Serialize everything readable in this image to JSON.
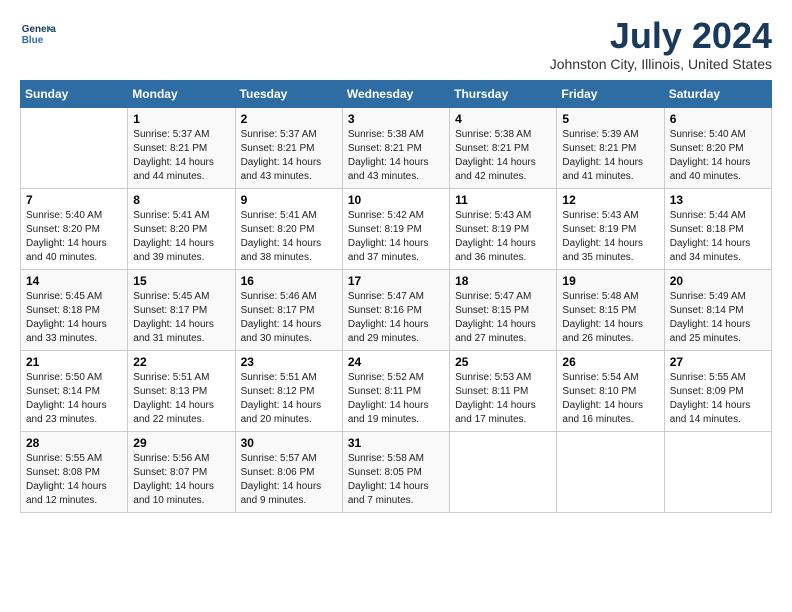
{
  "header": {
    "logo_line1": "General",
    "logo_line2": "Blue",
    "title": "July 2024",
    "subtitle": "Johnston City, Illinois, United States"
  },
  "weekdays": [
    "Sunday",
    "Monday",
    "Tuesday",
    "Wednesday",
    "Thursday",
    "Friday",
    "Saturday"
  ],
  "weeks": [
    [
      {
        "day": "",
        "info": ""
      },
      {
        "day": "1",
        "info": "Sunrise: 5:37 AM\nSunset: 8:21 PM\nDaylight: 14 hours\nand 44 minutes."
      },
      {
        "day": "2",
        "info": "Sunrise: 5:37 AM\nSunset: 8:21 PM\nDaylight: 14 hours\nand 43 minutes."
      },
      {
        "day": "3",
        "info": "Sunrise: 5:38 AM\nSunset: 8:21 PM\nDaylight: 14 hours\nand 43 minutes."
      },
      {
        "day": "4",
        "info": "Sunrise: 5:38 AM\nSunset: 8:21 PM\nDaylight: 14 hours\nand 42 minutes."
      },
      {
        "day": "5",
        "info": "Sunrise: 5:39 AM\nSunset: 8:21 PM\nDaylight: 14 hours\nand 41 minutes."
      },
      {
        "day": "6",
        "info": "Sunrise: 5:40 AM\nSunset: 8:20 PM\nDaylight: 14 hours\nand 40 minutes."
      }
    ],
    [
      {
        "day": "7",
        "info": "Sunrise: 5:40 AM\nSunset: 8:20 PM\nDaylight: 14 hours\nand 40 minutes."
      },
      {
        "day": "8",
        "info": "Sunrise: 5:41 AM\nSunset: 8:20 PM\nDaylight: 14 hours\nand 39 minutes."
      },
      {
        "day": "9",
        "info": "Sunrise: 5:41 AM\nSunset: 8:20 PM\nDaylight: 14 hours\nand 38 minutes."
      },
      {
        "day": "10",
        "info": "Sunrise: 5:42 AM\nSunset: 8:19 PM\nDaylight: 14 hours\nand 37 minutes."
      },
      {
        "day": "11",
        "info": "Sunrise: 5:43 AM\nSunset: 8:19 PM\nDaylight: 14 hours\nand 36 minutes."
      },
      {
        "day": "12",
        "info": "Sunrise: 5:43 AM\nSunset: 8:19 PM\nDaylight: 14 hours\nand 35 minutes."
      },
      {
        "day": "13",
        "info": "Sunrise: 5:44 AM\nSunset: 8:18 PM\nDaylight: 14 hours\nand 34 minutes."
      }
    ],
    [
      {
        "day": "14",
        "info": "Sunrise: 5:45 AM\nSunset: 8:18 PM\nDaylight: 14 hours\nand 33 minutes."
      },
      {
        "day": "15",
        "info": "Sunrise: 5:45 AM\nSunset: 8:17 PM\nDaylight: 14 hours\nand 31 minutes."
      },
      {
        "day": "16",
        "info": "Sunrise: 5:46 AM\nSunset: 8:17 PM\nDaylight: 14 hours\nand 30 minutes."
      },
      {
        "day": "17",
        "info": "Sunrise: 5:47 AM\nSunset: 8:16 PM\nDaylight: 14 hours\nand 29 minutes."
      },
      {
        "day": "18",
        "info": "Sunrise: 5:47 AM\nSunset: 8:15 PM\nDaylight: 14 hours\nand 27 minutes."
      },
      {
        "day": "19",
        "info": "Sunrise: 5:48 AM\nSunset: 8:15 PM\nDaylight: 14 hours\nand 26 minutes."
      },
      {
        "day": "20",
        "info": "Sunrise: 5:49 AM\nSunset: 8:14 PM\nDaylight: 14 hours\nand 25 minutes."
      }
    ],
    [
      {
        "day": "21",
        "info": "Sunrise: 5:50 AM\nSunset: 8:14 PM\nDaylight: 14 hours\nand 23 minutes."
      },
      {
        "day": "22",
        "info": "Sunrise: 5:51 AM\nSunset: 8:13 PM\nDaylight: 14 hours\nand 22 minutes."
      },
      {
        "day": "23",
        "info": "Sunrise: 5:51 AM\nSunset: 8:12 PM\nDaylight: 14 hours\nand 20 minutes."
      },
      {
        "day": "24",
        "info": "Sunrise: 5:52 AM\nSunset: 8:11 PM\nDaylight: 14 hours\nand 19 minutes."
      },
      {
        "day": "25",
        "info": "Sunrise: 5:53 AM\nSunset: 8:11 PM\nDaylight: 14 hours\nand 17 minutes."
      },
      {
        "day": "26",
        "info": "Sunrise: 5:54 AM\nSunset: 8:10 PM\nDaylight: 14 hours\nand 16 minutes."
      },
      {
        "day": "27",
        "info": "Sunrise: 5:55 AM\nSunset: 8:09 PM\nDaylight: 14 hours\nand 14 minutes."
      }
    ],
    [
      {
        "day": "28",
        "info": "Sunrise: 5:55 AM\nSunset: 8:08 PM\nDaylight: 14 hours\nand 12 minutes."
      },
      {
        "day": "29",
        "info": "Sunrise: 5:56 AM\nSunset: 8:07 PM\nDaylight: 14 hours\nand 10 minutes."
      },
      {
        "day": "30",
        "info": "Sunrise: 5:57 AM\nSunset: 8:06 PM\nDaylight: 14 hours\nand 9 minutes."
      },
      {
        "day": "31",
        "info": "Sunrise: 5:58 AM\nSunset: 8:05 PM\nDaylight: 14 hours\nand 7 minutes."
      },
      {
        "day": "",
        "info": ""
      },
      {
        "day": "",
        "info": ""
      },
      {
        "day": "",
        "info": ""
      }
    ]
  ]
}
